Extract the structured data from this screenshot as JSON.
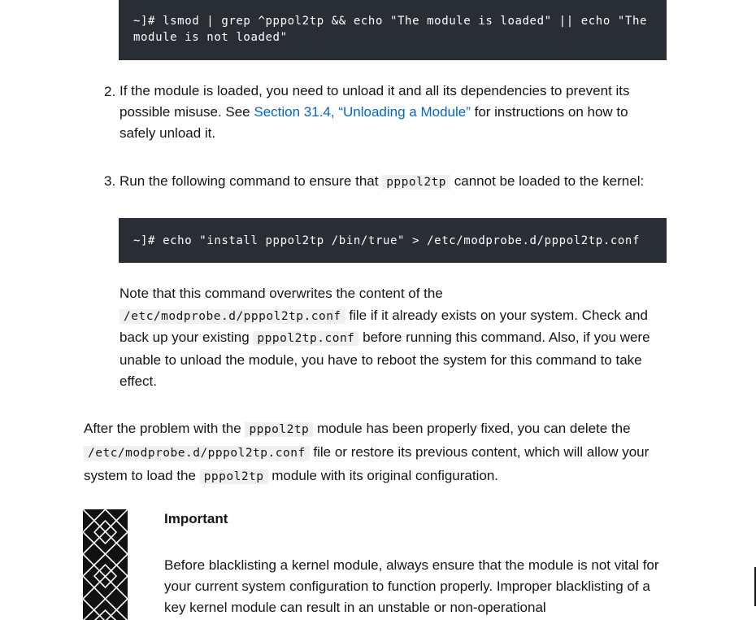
{
  "code_block_1": "~]# lsmod | grep ^pppol2tp && echo \"The module is loaded\" || echo \"The module is not loaded\"",
  "step2": {
    "number": "2.",
    "text_before": "If the module is loaded, you need to unload it and all its dependencies to prevent its possible misuse. See ",
    "link_text": "Section 31.4, “Unloading a Module”",
    "text_after": " for instructions on how to safely unload it."
  },
  "step3": {
    "number": "3.",
    "text_before": "Run the following command to ensure that ",
    "code": "pppol2tp",
    "text_after": " cannot be loaded to the kernel:"
  },
  "code_block_2": "~]# echo \"install pppol2tp /bin/true\" > /etc/modprobe.d/pppol2tp.conf",
  "note": {
    "text1": "Note that this command overwrites the content of the ",
    "code1": "/etc/modprobe.d/pppol2tp.conf",
    "text2": " file if it already exists on your system. Check and back up your existing ",
    "code2": "pppol2tp.conf",
    "text3": " before running this command. Also, if you were unable to unload the module, you have to reboot the system for this command to take effect."
  },
  "after_fix": {
    "text1": "After the problem with the ",
    "code1": "pppol2tp",
    "text2": " module has been properly fixed, you can delete the ",
    "code2": "/etc/modprobe.d/pppol2tp.conf",
    "text3": " file or restore its previous content, which will allow your system to load the ",
    "code3": "pppol2tp",
    "text4": " module with its original configuration."
  },
  "important": {
    "icon": "important-pattern-icon",
    "title": "Important",
    "text": "Before blacklisting a kernel module, always ensure that the module is not vital for your current system configuration to function properly. Improper blacklisting of a key kernel module can result in an unstable or non-operational"
  }
}
